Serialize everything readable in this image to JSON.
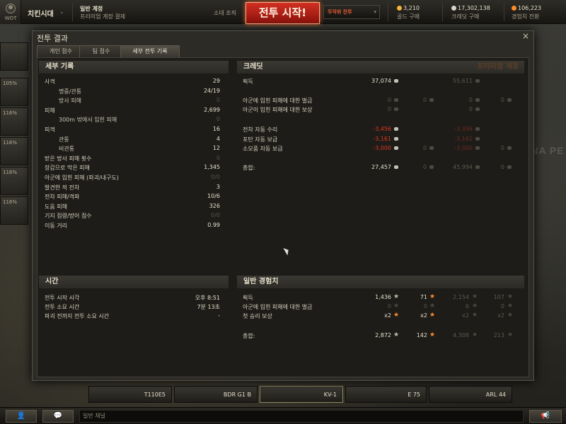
{
  "topbar": {
    "logo_label": "WOT",
    "player_name": "치킨시대",
    "account_type": "일반 계정",
    "premium_buy": "프리미엄 계정 결제",
    "squad": "소대 조직",
    "battle_button": "전투 시작!",
    "battle_mode": "무작위 전투",
    "gold_amount": "3,210",
    "gold_label": "골드 구매",
    "credit_amount": "17,302,138",
    "credit_label": "크레딧 구매",
    "xp_amount": "106,223",
    "xp_label": "경험치 전환"
  },
  "sidebar": {
    "pcts": [
      "105%",
      "116%",
      "116%",
      "116%",
      "116%"
    ]
  },
  "carousel": {
    "tanks": [
      "T110E5",
      "BDR G1 B",
      "KV-1",
      "E 75",
      "ARL 44"
    ]
  },
  "bottombar": {
    "chat_channel": "일반 채널"
  },
  "garage_sign": "ENA PE",
  "dialog": {
    "title": "전투 결과",
    "close": "×",
    "tabs": [
      "개인 점수",
      "팀 점수",
      "세부 전투 기록"
    ],
    "active_tab": 2,
    "details": {
      "header": "세부 기록",
      "rows": [
        {
          "label": "사격",
          "value": "29",
          "sub": false,
          "dim": false
        },
        {
          "label": "명중/관통",
          "value": "24/19",
          "sub": true,
          "dim": false
        },
        {
          "label": "방사 피해",
          "value": "0",
          "sub": true,
          "dim": true
        },
        {
          "label": "피해",
          "value": "2,699",
          "sub": false,
          "dim": false
        },
        {
          "label": "300m 밖에서 입힌 피해",
          "value": "0",
          "sub": true,
          "dim": true
        },
        {
          "label": "피격",
          "value": "16",
          "sub": false,
          "dim": false
        },
        {
          "label": "관통",
          "value": "4",
          "sub": true,
          "dim": false
        },
        {
          "label": "비관통",
          "value": "12",
          "sub": true,
          "dim": false
        },
        {
          "label": "받은 방사 피해 횟수",
          "value": "0",
          "sub": false,
          "dim": true
        },
        {
          "label": "장갑으로 막은 피해",
          "value": "1,345",
          "sub": false,
          "dim": false
        },
        {
          "label": "아군에 입힌 피해 (파괴/내구도)",
          "value": "0/0",
          "sub": false,
          "dim": true
        },
        {
          "label": "발견한 적 전차",
          "value": "3",
          "sub": false,
          "dim": false
        },
        {
          "label": "전차 피해/격파",
          "value": "10/6",
          "sub": false,
          "dim": false
        },
        {
          "label": "도움 피해",
          "value": "326",
          "sub": false,
          "dim": false
        },
        {
          "label": "기지 점령/방어 점수",
          "value": "0/0",
          "sub": false,
          "dim": true
        },
        {
          "label": "이동 거리",
          "value": "0.99",
          "sub": false,
          "dim": false
        }
      ]
    },
    "credits": {
      "header": "크레딧",
      "premium_header": "프리미엄 계정",
      "rows": [
        {
          "label": "획득",
          "base": "37,074",
          "base_style": "white",
          "p": "55,611",
          "p_style": "faded",
          "gold": "",
          "pgold": ""
        },
        {
          "label": "아군에 입힌 피해에 대한 벌금",
          "base": "0",
          "base_style": "dim",
          "p": "0",
          "p_style": "faded",
          "gold": "0",
          "pgold": "0"
        },
        {
          "label": "아군이 입힌 피해에 대한 보상",
          "base": "0",
          "base_style": "dim",
          "p": "0",
          "p_style": "faded",
          "gold": "",
          "pgold": ""
        },
        {
          "label": "전차 자동 수리",
          "base": "-3,456",
          "base_style": "red",
          "p": "-3,456",
          "p_style": "faded-red",
          "gold": "",
          "pgold": ""
        },
        {
          "label": "포탄 자동 보급",
          "base": "-3,161",
          "base_style": "red",
          "p": "-3,161",
          "p_style": "faded-red",
          "gold": "",
          "pgold": ""
        },
        {
          "label": "소모품 자동 보급",
          "base": "-3,000",
          "base_style": "red",
          "p": "-3,000",
          "p_style": "faded-red",
          "gold": "0",
          "pgold": "0"
        },
        {
          "label": "총합:",
          "base": "27,457",
          "base_style": "white",
          "p": "45,994",
          "p_style": "faded",
          "gold": "0",
          "pgold": "0"
        }
      ]
    },
    "time": {
      "header": "시간",
      "rows": [
        {
          "label": "전투 시작 시각",
          "value": "오후 8:51"
        },
        {
          "label": "전투 소요 시간",
          "value": "7분 13초"
        },
        {
          "label": "파괴 전까지 전투 소요 시간",
          "value": "-"
        }
      ]
    },
    "xp": {
      "header": "일반 경험치",
      "rows": [
        {
          "label": "획득",
          "xp": "1,436",
          "free": "71",
          "pxp": "2,154",
          "pfree": "107"
        },
        {
          "label": "아군에 입힌 피해에 대한 벌금",
          "xp": "0",
          "free": "0",
          "pxp": "0",
          "pfree": "0"
        },
        {
          "label": "첫 승리 보상",
          "xp": "x2",
          "free": "x2",
          "pxp": "x2",
          "pfree": "x2"
        },
        {
          "label": "총합:",
          "xp": "2,872",
          "free": "142",
          "pxp": "4,308",
          "pfree": "213"
        }
      ]
    }
  }
}
